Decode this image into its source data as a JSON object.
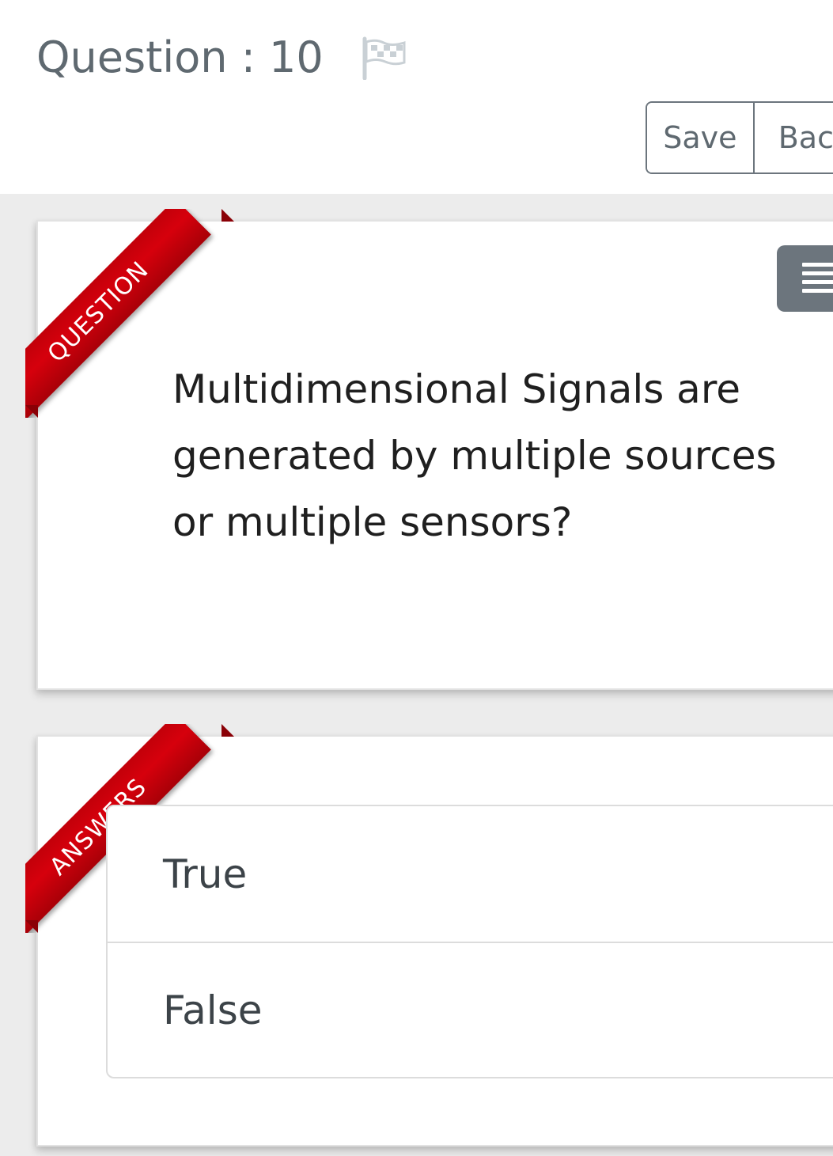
{
  "header": {
    "question_title": "Question : 10"
  },
  "toolbar": {
    "save_label": "Save",
    "back_label": "Back"
  },
  "question_card": {
    "ribbon_label": "QUESTION",
    "text": "Multidimensional Signals are generated by multiple sources or multiple sensors?"
  },
  "answers_card": {
    "ribbon_label": "ANSWERS",
    "options": [
      {
        "label": "True"
      },
      {
        "label": "False"
      }
    ]
  },
  "colors": {
    "ribbon_red": "#d6000c",
    "text_gray": "#5f6970",
    "button_gray": "#6c757d"
  },
  "icons": {
    "flag": "flag-icon",
    "menu": "menu-icon"
  }
}
